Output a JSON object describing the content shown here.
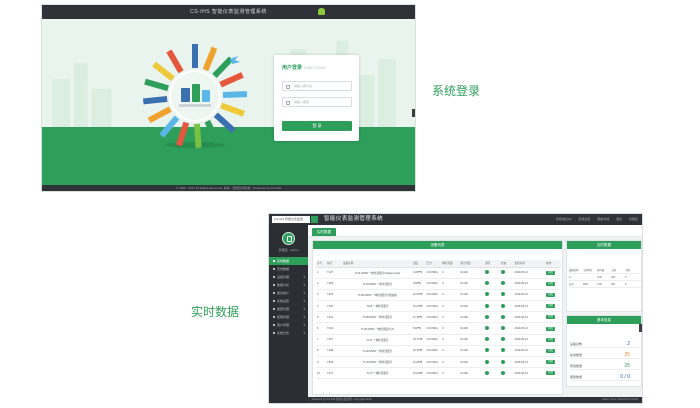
{
  "login_screen": {
    "window_title": "CS-IHS    智能仪表监测管理系统",
    "card": {
      "title": "用户登录",
      "subtitle": "USER LOGIN",
      "username_placeholder": "请输入用户名",
      "password_placeholder": "请输入密码",
      "login_button": "登 录"
    },
    "footer": "© 2005 - 2017 All Rights Reserved. 版本 · 智能监测系统 · Produced by CS-IHS"
  },
  "captions": {
    "login": "系统登录",
    "realtime": "实时数据"
  },
  "dashboard": {
    "project_select": "CS-IHS 智能仪表监测",
    "app_title": "智能仪表监测管理系统",
    "top_links": [
      "系统消息(0)",
      "系统设置",
      "帮助文档",
      "退出",
      "管理员"
    ],
    "user_label": "管理员 · admin",
    "nav": [
      {
        "label": "实时数据",
        "active": true,
        "has_arrow": false
      },
      {
        "label": "历史数据",
        "active": false,
        "has_arrow": false
      },
      {
        "label": "设备管理",
        "active": false,
        "has_arrow": true
      },
      {
        "label": "数据分析",
        "active": false,
        "has_arrow": true
      },
      {
        "label": "报表统计",
        "active": false,
        "has_arrow": true
      },
      {
        "label": "系统设置",
        "active": false,
        "has_arrow": true
      },
      {
        "label": "报警管理",
        "active": false,
        "has_arrow": true
      },
      {
        "label": "权限管理",
        "active": false,
        "has_arrow": true
      },
      {
        "label": "用户管理",
        "active": false,
        "has_arrow": true
      },
      {
        "label": "系统日志",
        "active": false,
        "has_arrow": true
      }
    ],
    "tab_label": "实时数据",
    "device_panel": {
      "title": "设备列表",
      "pager": [
        "«",
        "‹",
        "1",
        "2",
        "›",
        "»"
      ],
      "columns": [
        "序号",
        "站号",
        "设备名称",
        "温度",
        "压力",
        "瞬时流量",
        "累计流量",
        "通讯",
        "状态",
        "更新时间",
        "操作"
      ],
      "rows": [
        [
          "1",
          "T127",
          "TL01 DN50 一体化流量计(Saisaml-test)",
          "11.85",
          "℃",
          "0.00",
          "MPa",
          "0",
          "Nm3/h",
          "2019-05-14",
          "详情"
        ],
        [
          "2",
          "T128",
          "TL03 DN50 一体化流量计",
          "9.66",
          "℃",
          "0.00",
          "MPa",
          "0",
          "Nm3/h",
          "2019-05-14",
          "详情"
        ],
        [
          "3",
          "T129",
          "TL05 DN50 一体化流量计(测试站)",
          "12.06",
          "℃",
          "0.00",
          "MPa",
          "0",
          "Nm3/h",
          "2019-05-14",
          "详情"
        ],
        [
          "4",
          "T130",
          "TL06 一体化流量计",
          "12.00",
          "℃",
          "0.00",
          "MPa",
          "0",
          "Nm3/h",
          "2019-05-14",
          "详情"
        ],
        [
          "5",
          "T131",
          "TL08 DN50 一体化流量计",
          "11.40",
          "℃",
          "0.00",
          "MPa",
          "0",
          "Nm3/h",
          "2019-05-14",
          "详情"
        ],
        [
          "6",
          "T132",
          "TL09 DN50 一体化流量计(A)",
          "8.18",
          "℃",
          "0.00",
          "MPa",
          "0",
          "Nm3/h",
          "2019-05-14",
          "详情"
        ],
        [
          "7",
          "T137",
          "TL17 一体化流量计",
          "10.71",
          "℃",
          "0.00",
          "MPa",
          "0",
          "Nm3/h",
          "2019-05-14",
          "详情"
        ],
        [
          "8",
          "T138",
          "TL18 DN50 一体化流量计",
          "10.33",
          "℃",
          "0.00",
          "MPa",
          "0",
          "Nm3/h",
          "2019-05-14",
          "详情"
        ],
        [
          "9",
          "T139",
          "TL19 DN50 一体化流量计",
          "11.00",
          "℃",
          "0.00",
          "MPa",
          "0",
          "Nm3/h",
          "2019-05-14",
          "详情"
        ],
        [
          "10",
          "T170",
          "TL70 一体化流量计",
          "12.04",
          "℃",
          "0.00",
          "MPa",
          "0",
          "Nm3/h",
          "2019-05-14",
          "详情"
        ]
      ]
    },
    "realtime_panel": {
      "title": "实时数据",
      "columns": [
        "通道名称",
        "工程单位",
        "实时值",
        "上限",
        "下限"
      ],
      "rows": [
        [
          "A",
          "",
          "0.00",
          "100",
          "0"
        ],
        [
          "压力",
          "MPa",
          "0.00",
          "100",
          "0"
        ]
      ]
    },
    "base_panel": {
      "title": "基本信息",
      "stats": [
        {
          "label": "设备总数",
          "value": "2",
          "color": "#2f5fa8"
        },
        {
          "label": "在线数量",
          "value": "25",
          "color": "#e08a2b"
        },
        {
          "label": "离线数量",
          "value": "25",
          "color": "#2e9e5b"
        },
        {
          "label": "报警数量",
          "value": "0 / 0",
          "color": "#2f5fa8"
        }
      ]
    },
    "footer_left": "Powered by CS-IHS 智能仪表监测 · Copyright 2019",
    "footer_right": "Server Time: 2019-05-14 09:30"
  },
  "colors": {
    "brand_green": "#2e9e5b",
    "dark_bar": "#2f3238",
    "sidebar": "#2b2e33"
  }
}
